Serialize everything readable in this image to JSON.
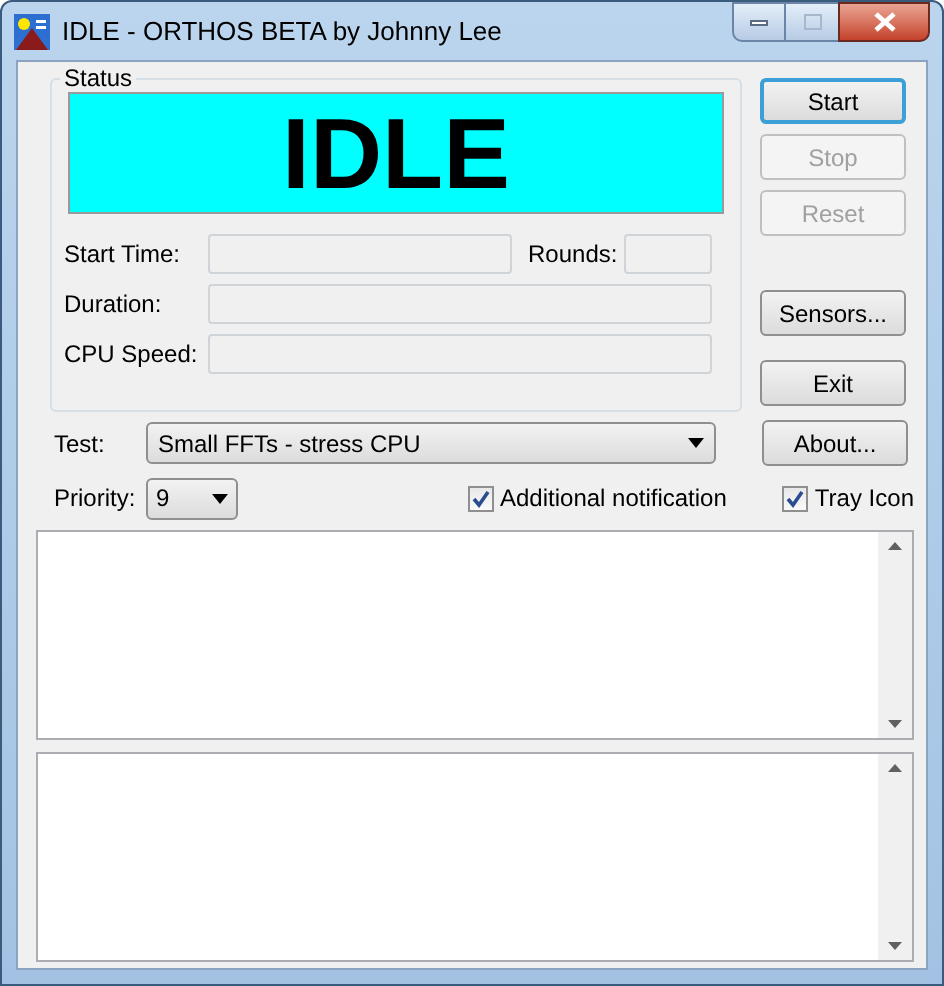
{
  "window": {
    "title": "IDLE - ORTHOS BETA by Johnny Lee"
  },
  "status": {
    "label": "Status",
    "display": "IDLE",
    "fields": [
      {
        "label": "Start Time:"
      },
      {
        "label": "Rounds:"
      },
      {
        "label": "Duration:"
      },
      {
        "label": "CPU Speed:"
      }
    ]
  },
  "buttons": [
    {
      "label": "Start",
      "disabled": false,
      "default": true
    },
    {
      "label": "Stop",
      "disabled": true,
      "default": false
    },
    {
      "label": "Reset",
      "disabled": true,
      "default": false
    },
    {
      "label": "Sensors...",
      "disabled": false,
      "default": false
    },
    {
      "label": "Exit",
      "disabled": false,
      "default": false
    },
    {
      "label": "About...",
      "disabled": false,
      "default": false
    }
  ],
  "test": {
    "label": "Test:",
    "value": "Small FFTs - stress CPU"
  },
  "priority": {
    "label": "Priority:",
    "value": "9"
  },
  "checkboxes": [
    {
      "label": "Additional notification",
      "checked": true
    },
    {
      "label": "Tray Icon",
      "checked": true
    }
  ]
}
